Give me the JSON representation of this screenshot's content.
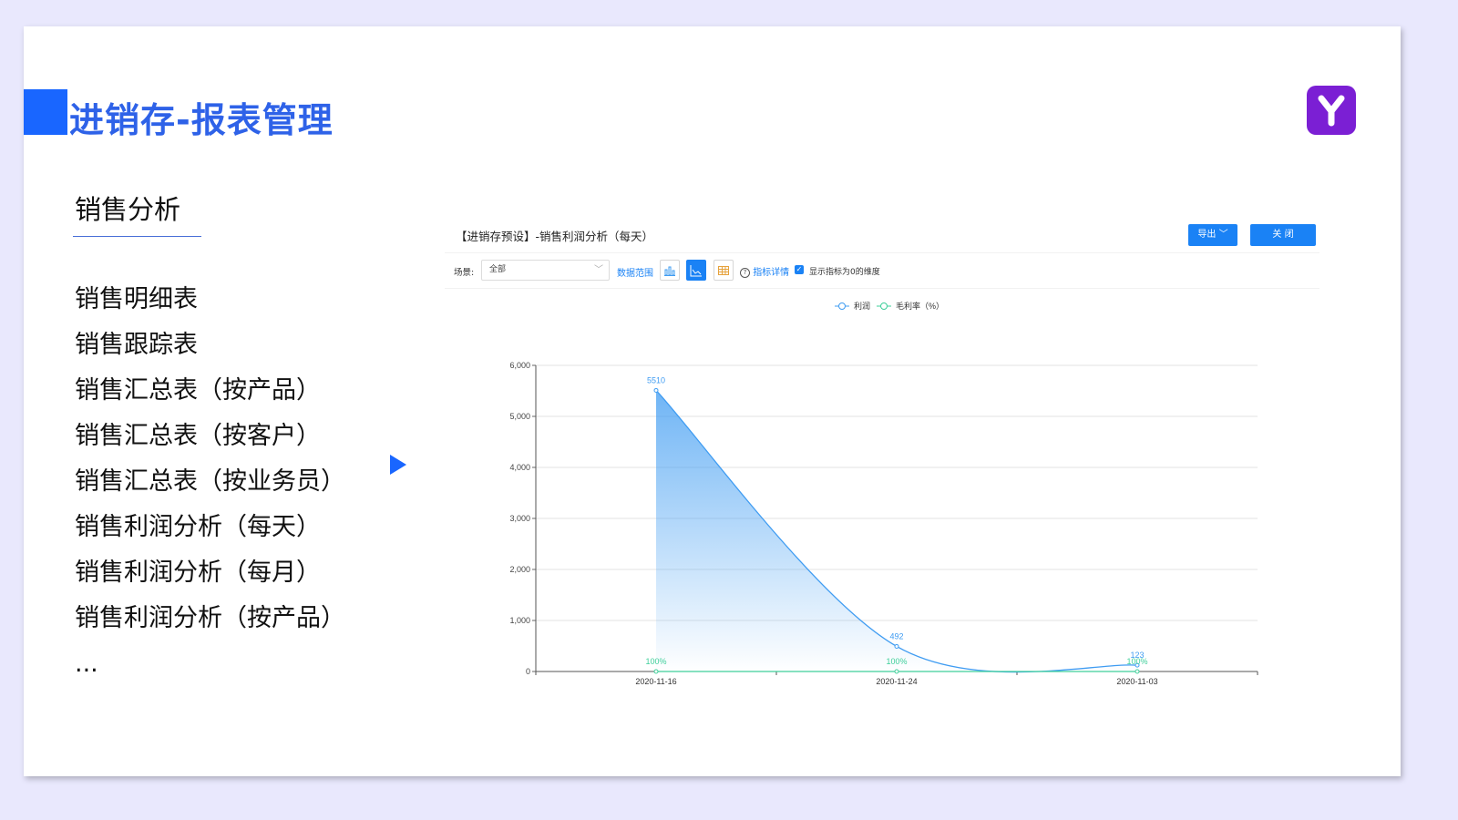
{
  "slide": {
    "title": "进销存-报表管理",
    "section_heading": "销售分析",
    "menu_items": [
      "销售明细表",
      "销售跟踪表",
      "销售汇总表（按产品）",
      "销售汇总表（按客户）",
      "销售汇总表（按业务员）",
      "销售利润分析（每天）",
      "销售利润分析（每月）",
      "销售利润分析（按产品）",
      "..."
    ]
  },
  "report": {
    "title": "【进销存预设】-销售利润分析（每天）",
    "export_label": "导出 ﹀",
    "close_label": "关 闭",
    "scene_label": "场景:",
    "scene_value": "全部",
    "data_range_label": "数据范围",
    "metric_detail_label": "指标详情",
    "show_zero_label": "显示指标为0的维度"
  },
  "colors": {
    "accent": "#1966ff",
    "profit": "#3f9cf2",
    "margin": "#3ecf9a",
    "button": "#1a82f5"
  },
  "chart_data": {
    "type": "line",
    "x": [
      "2020-11-16",
      "2020-11-24",
      "2020-11-03"
    ],
    "series": [
      {
        "name": "利润",
        "values": [
          5510,
          492,
          123
        ],
        "labels": [
          "5510",
          "492",
          "123"
        ],
        "area": true,
        "color": "#3f9cf2"
      },
      {
        "name": "毛利率（%）",
        "values": [
          0,
          0,
          0
        ],
        "labels": [
          "100%",
          "100%",
          "100%"
        ],
        "color": "#3ecf9a"
      }
    ],
    "ylim": [
      0,
      6000
    ],
    "yticks": [
      "0",
      "1,000",
      "2,000",
      "3,000",
      "4,000",
      "5,000",
      "6,000"
    ],
    "legend_position": "top-center",
    "grid": true
  }
}
